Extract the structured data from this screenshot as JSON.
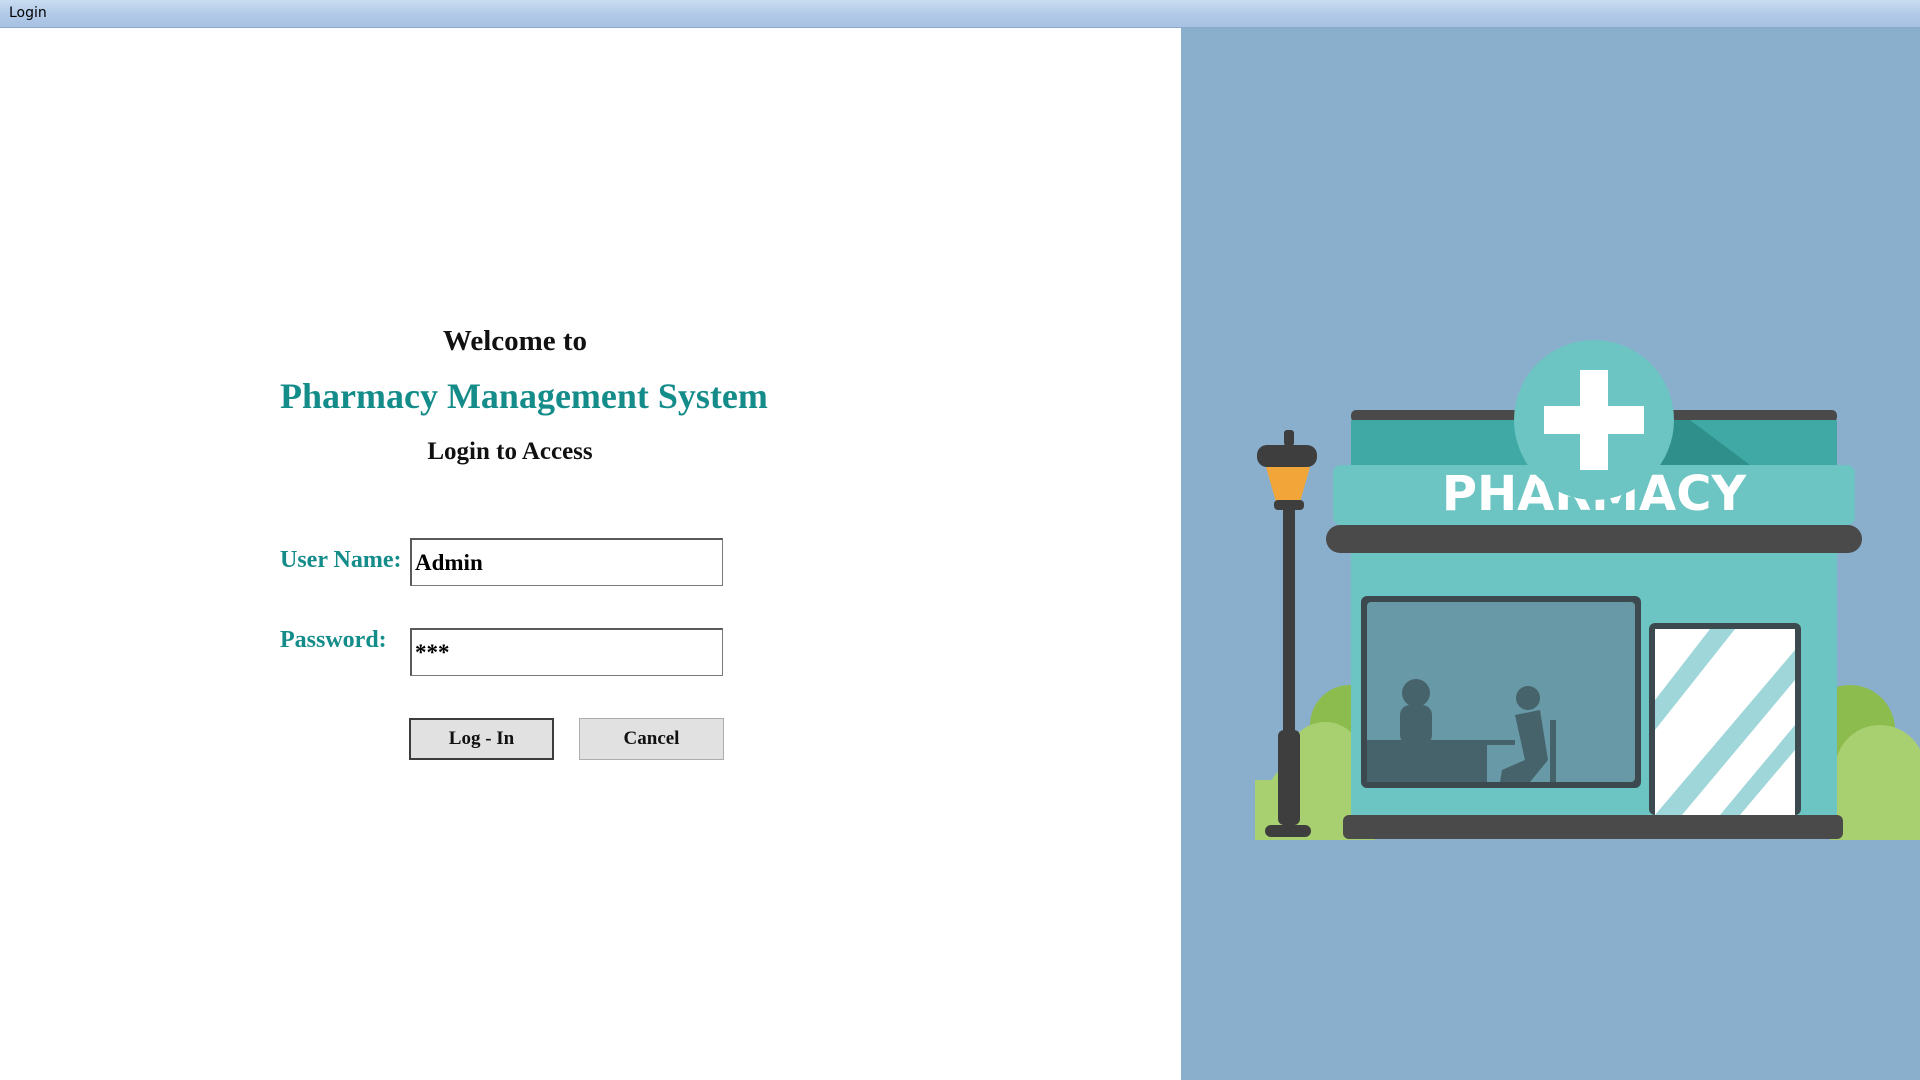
{
  "window": {
    "title": "Login"
  },
  "login": {
    "welcome": "Welcome to",
    "app_title": "Pharmacy Management System",
    "subtitle": "Login to Access",
    "username_label": "User Name:",
    "username_value": "Admin",
    "password_label": "Password:",
    "password_value": "***",
    "login_button": "Log - In",
    "cancel_button": "Cancel"
  },
  "illustration": {
    "sign_text": "PHARMACY",
    "icons": [
      "pharmacy-storefront-icon",
      "medical-cross-icon",
      "street-lamp-icon"
    ]
  },
  "colors": {
    "accent": "#148c8a",
    "right_panel": "#8aafcd",
    "store_teal": "#6cc5c2",
    "store_dark_teal": "#40a9a5",
    "lamp_orange": "#f2a63a",
    "bush_green": "#a8d071"
  }
}
